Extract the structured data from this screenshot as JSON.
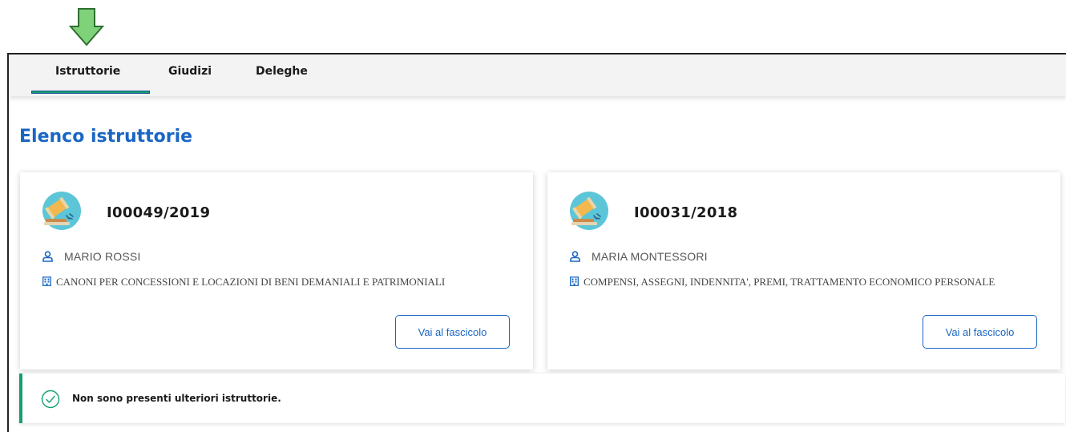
{
  "tabs": [
    {
      "label": "Istruttorie",
      "active": true
    },
    {
      "label": "Giudizi",
      "active": false
    },
    {
      "label": "Deleghe",
      "active": false
    }
  ],
  "page_title": "Elenco istruttorie",
  "cards": [
    {
      "code": "I00049/2019",
      "person": "MARIO ROSSI",
      "subject": "CANONI PER CONCESSIONI E LOCAZIONI DI BENI DEMANIALI E PATRIMONIALI",
      "button_label": "Vai al fascicolo",
      "avatar_icon": "gavel-icon",
      "person_icon": "user-icon",
      "subject_icon": "building-icon"
    },
    {
      "code": "I00031/2018",
      "person": "MARIA MONTESSORI",
      "subject": "COMPENSI, ASSEGNI, INDENNITA', PREMI, TRATTAMENTO ECONOMICO PERSONALE",
      "button_label": "Vai al fascicolo",
      "avatar_icon": "gavel-icon",
      "person_icon": "user-icon",
      "subject_icon": "building-icon"
    }
  ],
  "notice": {
    "text": "Non sono presenti ulteriori istruttorie.",
    "icon": "check-circle-icon"
  },
  "colors": {
    "accent_blue": "#1a66c4",
    "accent_green": "#12a06b",
    "annotation_arrow": "#7fd17a"
  }
}
